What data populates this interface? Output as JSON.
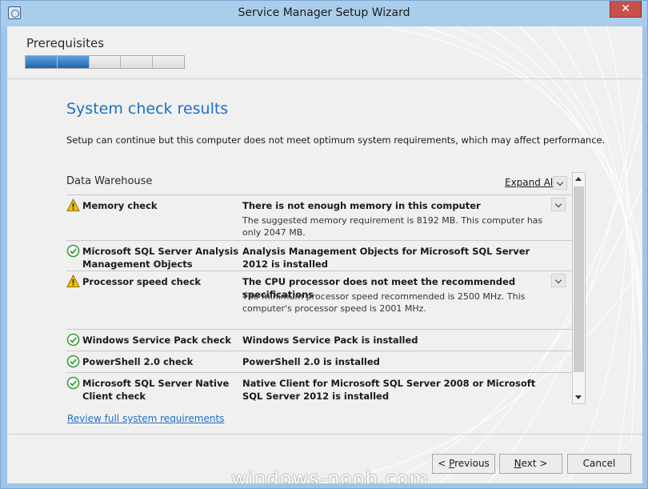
{
  "window": {
    "title": "Service Manager Setup Wizard",
    "close_glyph": "✕"
  },
  "header": {
    "step_title": "Prerequisites",
    "progress_segments": 5,
    "progress_completed": 2
  },
  "page": {
    "heading": "System check results",
    "description": "Setup can continue but this computer does not meet optimum system requirements, which may affect performance."
  },
  "group": {
    "title": "Data Warehouse",
    "expand_all": "Expand All"
  },
  "checks": [
    {
      "status": "warning",
      "icon": "warning-icon",
      "name": "Memory check",
      "result": "There is not enough memory in this computer",
      "detail": "The suggested memory requirement is 8192 MB. This computer has only 2047 MB.",
      "expanded": true
    },
    {
      "status": "passed",
      "icon": "check-circle-icon",
      "name": "Microsoft SQL Server Analysis Management Objects",
      "result": "Analysis Management Objects for Microsoft SQL Server 2012 is installed",
      "detail": "",
      "expanded": false
    },
    {
      "status": "warning",
      "icon": "warning-icon",
      "name": "Processor speed check",
      "result": "The CPU processor does not meet the recommended specifications",
      "detail": "The minimum processor speed recommended is 2500 MHz. This computer's processor speed is 2001 MHz.",
      "expanded": true
    },
    {
      "status": "passed",
      "icon": "check-circle-icon",
      "name": "Windows Service Pack check",
      "result": "Windows Service Pack is installed",
      "detail": "",
      "expanded": false
    },
    {
      "status": "passed",
      "icon": "check-circle-icon",
      "name": "PowerShell 2.0 check",
      "result": "PowerShell 2.0 is installed",
      "detail": "",
      "expanded": false
    },
    {
      "status": "passed",
      "icon": "check-circle-icon",
      "name": "Microsoft SQL Server Native Client check",
      "result": "Native Client for Microsoft SQL Server 2008 or Microsoft SQL Server 2012 is installed",
      "detail": "",
      "expanded": false
    }
  ],
  "links": {
    "review": "Review full system requirements"
  },
  "buttons": {
    "previous": {
      "prefix": "< ",
      "accel": "P",
      "rest": "revious"
    },
    "next": {
      "accel": "N",
      "rest": "ext >"
    },
    "cancel": "Cancel"
  },
  "watermark": "windows-noob.com",
  "colors": {
    "accent_blue": "#1f6fc4",
    "progress_fill": "#1f64b4",
    "warning": "#f2c200",
    "passed": "#3a9a3a",
    "close_red": "#c7504a"
  }
}
